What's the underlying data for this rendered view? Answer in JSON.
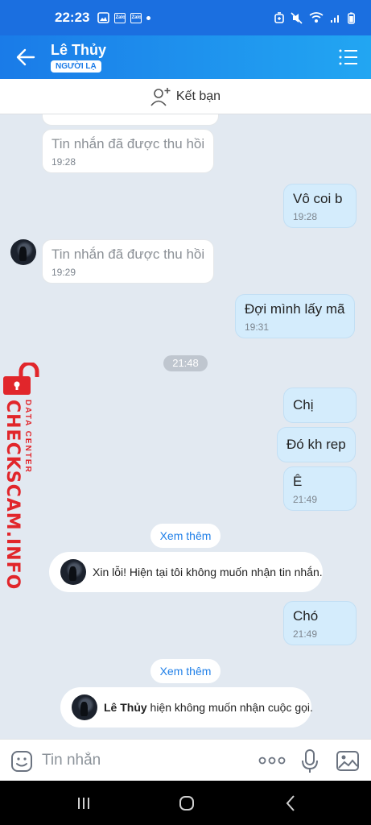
{
  "status_bar": {
    "time": "22:23",
    "app_icons": [
      "gallery-icon",
      "zalo-icon",
      "zalo-icon"
    ],
    "zalo_label": "Zalo"
  },
  "header": {
    "contact_name": "Lê Thủy",
    "badge": "NGƯỜI LẠ"
  },
  "add_friend": {
    "label": "Kết bạn"
  },
  "messages": [
    {
      "side": "in",
      "text": "Tin nhắn đã được thu hồi",
      "time": "19:28",
      "recalled": true
    },
    {
      "side": "out",
      "text": "Vô coi b",
      "time": "19:28"
    },
    {
      "side": "in",
      "text": "Tin nhắn đã được thu hồi",
      "time": "19:29",
      "recalled": true,
      "avatar": true
    },
    {
      "side": "out",
      "text": "Đợi mình lấy mã",
      "time": "19:31"
    },
    {
      "side": "out",
      "text": "Chị",
      "time": ""
    },
    {
      "side": "out",
      "text": "Đó kh rep",
      "time": ""
    },
    {
      "side": "out",
      "text": "Ê",
      "time": "21:49"
    },
    {
      "side": "out",
      "text": "Chó",
      "time": "21:49"
    }
  ],
  "time_divider": "21:48",
  "see_more_label": "Xem thêm",
  "notices": {
    "no_messages": "Xin lỗi! Hiện tại tôi không muốn nhận tin nhắn.",
    "no_calls_name": "Lê Thủy",
    "no_calls_text": " hiện không muốn nhận cuộc gọi."
  },
  "watermark": {
    "big": "CHECKSCAM.INFO",
    "small": "DATA CENTER"
  },
  "input": {
    "placeholder": "Tin nhắn",
    "value": ""
  },
  "colors": {
    "header_blue": "#1a7be8",
    "outgoing_bubble": "#d4ecfc",
    "chat_background": "#e2e9f1",
    "watermark_red": "#e1262b"
  }
}
